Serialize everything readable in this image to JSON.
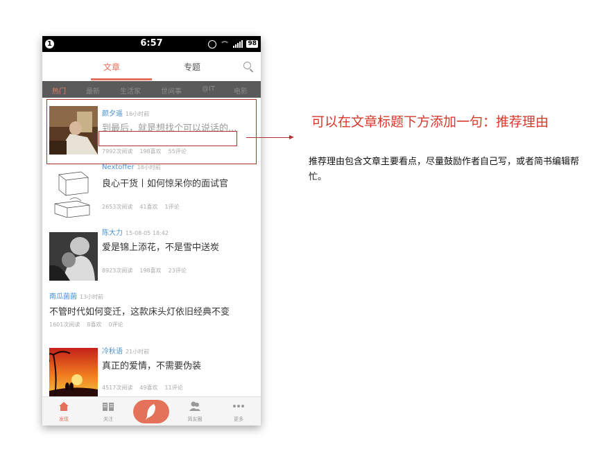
{
  "status_bar": {
    "notification_count": "1",
    "time": "6:57",
    "battery": "98"
  },
  "header": {
    "tabs": [
      "文章",
      "专题"
    ],
    "active_tab": "文章"
  },
  "categories": [
    "热门",
    "最新",
    "生活家",
    "世间事",
    "@IT",
    "电影"
  ],
  "feed": [
    {
      "author": "颜夕遥",
      "time": "16小时前",
      "title": "到最后，就是想找个可以说话的...",
      "reads": "7992次阅读",
      "likes": "198喜欢",
      "comments": "55评论",
      "thumb": "reading-photo"
    },
    {
      "author": "Nextoffer",
      "time": "18小时前",
      "title": "良心干货丨如何惊呆你的面试官",
      "reads": "2653次阅读",
      "likes": "41喜欢",
      "comments": "1评论",
      "thumb": "sketch"
    },
    {
      "author": "陈大力",
      "time": "15-08-05 18:42",
      "title": "爱是锦上添花，不是雪中送炭",
      "reads": "8923次阅读",
      "likes": "198喜欢",
      "comments": "23评论",
      "thumb": "bw-photo"
    },
    {
      "author": "南瓜菌菌",
      "time": "13小时前",
      "title": "不管时代如何变迁，这款床头灯依旧经典不变",
      "reads": "1601次阅读",
      "likes": "8喜欢",
      "comments": "0评论"
    },
    {
      "author": "冷秋语",
      "time": "21小时前",
      "title": "真正的爱情，不需要伪装",
      "reads": "4517次阅读",
      "likes": "49喜欢",
      "comments": "11评论",
      "thumb": "sunset-photo"
    }
  ],
  "bottom_nav": [
    {
      "label": "发现",
      "icon": "home-icon"
    },
    {
      "label": "关注",
      "icon": "book-icon"
    },
    {
      "label": "",
      "icon": "feather-icon"
    },
    {
      "label": "简友圈",
      "icon": "friends-icon"
    },
    {
      "label": "更多",
      "icon": "more-icon"
    }
  ],
  "annotation": {
    "title": "可以在文章标题下方添加一句：推荐理由",
    "body": "推荐理由包含文章主要看点，尽量鼓励作者自己写，或者简书编辑帮忙。"
  },
  "colors": {
    "accent": "#e4725a",
    "annotation": "#d8392b",
    "link": "#4a90d9"
  }
}
